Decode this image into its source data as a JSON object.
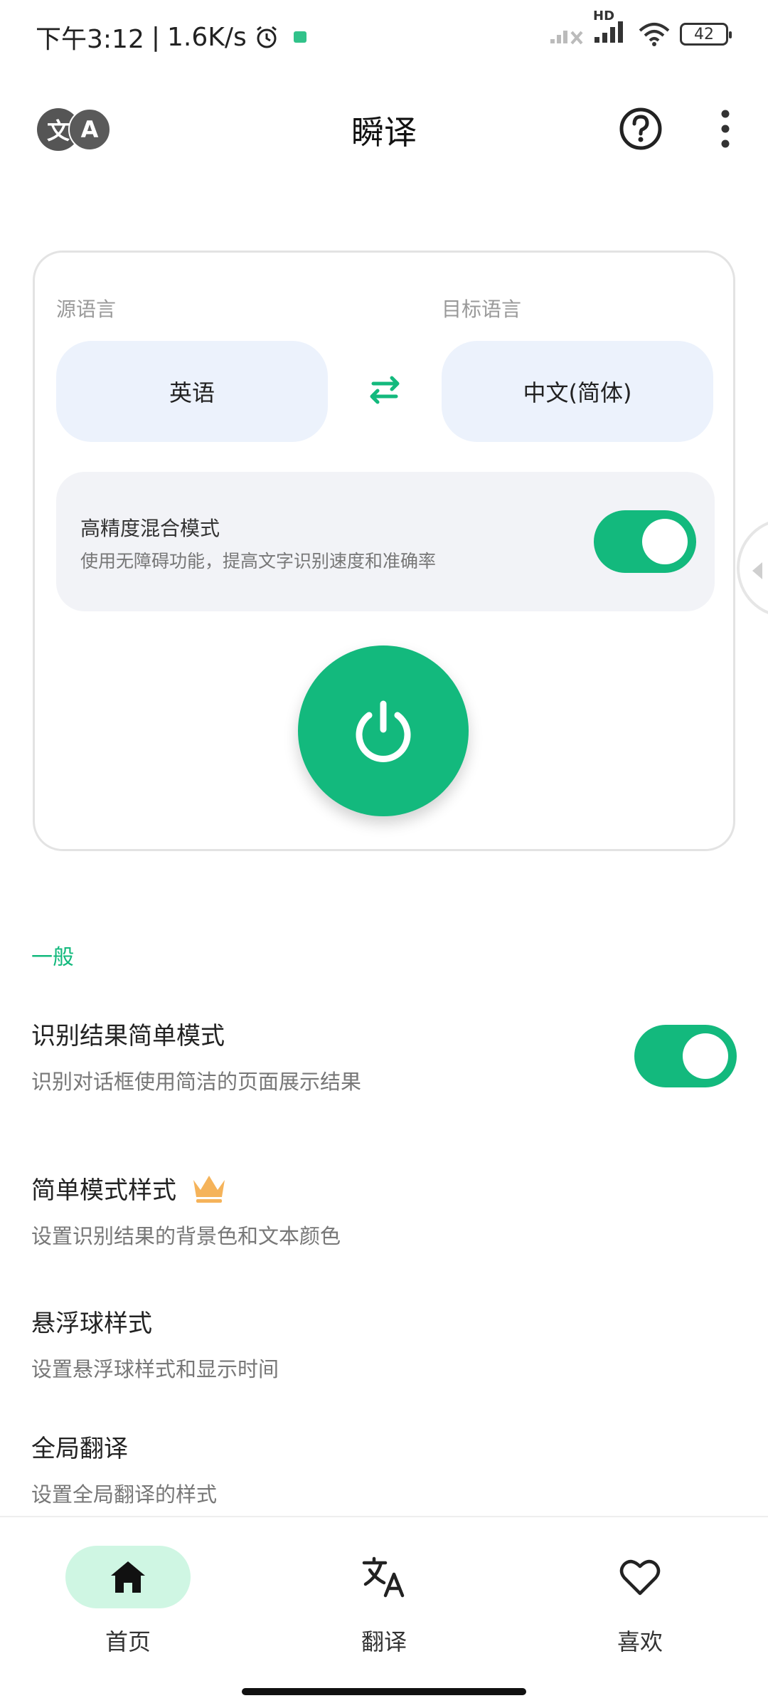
{
  "status_bar": {
    "time": "下午3:12",
    "speed": "1.6K/s",
    "network_label": "HD",
    "battery": "42"
  },
  "app_bar": {
    "logo_left": "文",
    "logo_right": "A",
    "title": "瞬译"
  },
  "translator_card": {
    "source_label": "源语言",
    "target_label": "目标语言",
    "source_language": "英语",
    "target_language": "中文(简体)",
    "mode_title": "高精度混合模式",
    "mode_subtitle": "使用无障碍功能，提高文字识别速度和准确率",
    "mode_enabled": true
  },
  "settings": {
    "section_title": "一般",
    "items": [
      {
        "title": "识别结果简单模式",
        "subtitle": "识别对话框使用简洁的页面展示结果",
        "enabled": true
      },
      {
        "title": "简单模式样式",
        "subtitle": "设置识别结果的背景色和文本颜色",
        "badge_icon": "crown-icon"
      },
      {
        "title": "悬浮球样式",
        "subtitle": "设置悬浮球样式和显示时间"
      },
      {
        "title": "全局翻译",
        "subtitle": "设置全局翻译的样式"
      }
    ]
  },
  "bottom_nav": {
    "items": [
      {
        "label": "首页",
        "icon": "home-icon",
        "active": true
      },
      {
        "label": "翻译",
        "icon": "translate-icon",
        "active": false
      },
      {
        "label": "喜欢",
        "icon": "heart-icon",
        "active": false
      }
    ]
  },
  "colors": {
    "accent": "#13b97d",
    "pill_bg": "#ecf2fc",
    "panel_bg": "#f2f3f7",
    "nav_active_bg": "#cff6e3",
    "crown": "#f5b35a"
  }
}
